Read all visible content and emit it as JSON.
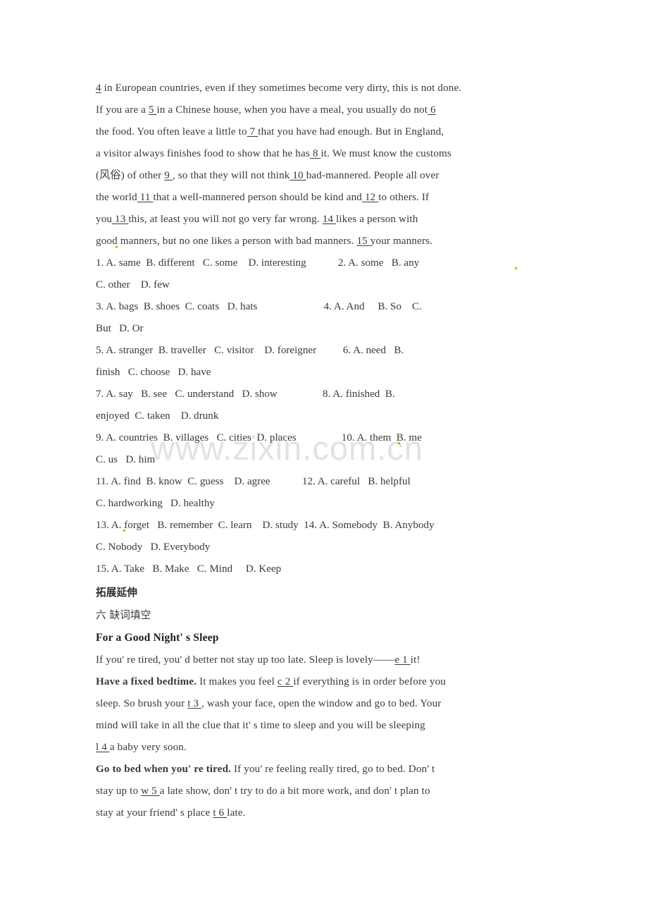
{
  "document": {
    "watermark": "www.zixin.com.cn",
    "cloze_passage": {
      "lines": [
        {
          "id": "l1",
          "parts": [
            {
              "t": "4",
              "style": "blank"
            },
            {
              "t": "  in European countries, even if they sometimes become very dirty, this is not done.",
              "style": "plain"
            }
          ]
        },
        {
          "id": "l2",
          "parts": [
            {
              "t": "If you are a ",
              "style": "plain"
            },
            {
              "t": " 5 ",
              "style": "blank"
            },
            {
              "t": "in a Chinese house, when you have a meal, you usually do not",
              "style": "plain"
            },
            {
              "t": " 6",
              "style": "blank"
            }
          ]
        },
        {
          "id": "l3",
          "parts": [
            {
              "t": "the food. You often leave a little to",
              "style": "plain"
            },
            {
              "t": " 7 ",
              "style": "blank"
            },
            {
              "t": "that you have had enough. But in England,",
              "style": "plain"
            }
          ]
        },
        {
          "id": "l4",
          "parts": [
            {
              "t": "a visitor always finishes food to show that he has",
              "style": "plain"
            },
            {
              "t": " 8 ",
              "style": "blank"
            },
            {
              "t": "it. We must know the customs",
              "style": "plain"
            }
          ]
        },
        {
          "id": "l5",
          "parts": [
            {
              "t": "(风俗) of other ",
              "style": "cn-inline"
            },
            {
              "t": " 9 ",
              "style": "blank"
            },
            {
              "t": ", so that they will not think",
              "style": "plain"
            },
            {
              "t": " 10 ",
              "style": "blank"
            },
            {
              "t": "bad-mannered. People all over",
              "style": "plain"
            }
          ]
        },
        {
          "id": "l6",
          "parts": [
            {
              "t": "the world",
              "style": "plain"
            },
            {
              "t": " 11 ",
              "style": "blank"
            },
            {
              "t": "that a well-mannered person should be kind and",
              "style": "plain"
            },
            {
              "t": " 12 ",
              "style": "blank"
            },
            {
              "t": "to others. If",
              "style": "plain"
            }
          ]
        },
        {
          "id": "l7",
          "parts": [
            {
              "t": "you",
              "style": "plain"
            },
            {
              "t": " 13 ",
              "style": "blank"
            },
            {
              "t": "this, at least you will not go very far wrong. ",
              "style": "plain"
            },
            {
              "t": " 14 ",
              "style": "blank"
            },
            {
              "t": "likes a person with",
              "style": "plain"
            }
          ]
        },
        {
          "id": "l8",
          "parts": [
            {
              "t": "good manners, but no one likes a person with bad manners. ",
              "style": "plain"
            },
            {
              "t": " 15 ",
              "style": "blank"
            },
            {
              "t": " your manners.",
              "style": "plain"
            }
          ]
        }
      ]
    },
    "choices": {
      "lines": [
        "1. A. same  B. different   C. some    D. interesting            2. A. some   B. any",
        "C. other    D. few",
        "3. A. bags  B. shoes  C. coats   D. hats                         4. A. And     B. So    C.",
        "But   D. Or",
        "5. A. stranger  B. traveller   C. visitor    D. foreigner          6. A. need   B.",
        "finish   C. choose   D. have",
        "7. A. say   B. see   C. understand   D. show                 8. A. finished  B.",
        "enjoyed  C. taken    D. drunk",
        "9. A. countries  B. villages   C. cities  D. places                 10. A. them  B. me",
        "C. us   D. him",
        "11. A. find  B. know  C. guess    D. agree            12. A. careful   B. helpful",
        "C. hardworking   D. healthy",
        "13. A. forget   B. remember  C. learn    D. study  14. A. Somebody  B. Anybody",
        "C. Nobody   D. Everybody",
        "15. A. Take   B. Make   C. Mind     D. Keep"
      ]
    },
    "section_heading": "拓展延伸",
    "exercise_heading": "六 缺词填空",
    "passage_title": "For a Good Night' s Sleep",
    "word_fill_passage": {
      "lines": [
        {
          "id": "w1",
          "parts": [
            {
              "t": "If you' re tired, you' d better not stay up too late. Sleep is lovely——",
              "style": "plain"
            },
            {
              "t": "e  1 ",
              "style": "blank"
            },
            {
              "t": " it!",
              "style": "plain"
            }
          ]
        },
        {
          "id": "w2",
          "parts": [
            {
              "t": "Have a fixed bedtime.",
              "style": "bold"
            },
            {
              "t": " It makes you feel ",
              "style": "plain"
            },
            {
              "t": "c  2 ",
              "style": "blank"
            },
            {
              "t": " if everything is in order before you",
              "style": "plain"
            }
          ]
        },
        {
          "id": "w3",
          "parts": [
            {
              "t": "sleep. So brush your ",
              "style": "plain"
            },
            {
              "t": "t  3 ",
              "style": "blank"
            },
            {
              "t": ", wash your face, open the window and go to bed. Your",
              "style": "plain"
            }
          ]
        },
        {
          "id": "w4",
          "parts": [
            {
              "t": "mind will take in all the clue that it' s time to sleep and you will be sleeping",
              "style": "plain"
            }
          ]
        },
        {
          "id": "w5",
          "parts": [
            {
              "t": "l  4  ",
              "style": "blank"
            },
            {
              "t": "a baby very soon.",
              "style": "plain"
            }
          ]
        },
        {
          "id": "w6",
          "parts": [
            {
              "t": "Go to bed when you' re tired.",
              "style": "bold"
            },
            {
              "t": " If you' re feeling really tired, go to bed. Don' t",
              "style": "plain"
            }
          ]
        },
        {
          "id": "w7",
          "parts": [
            {
              "t": "stay up to ",
              "style": "plain"
            },
            {
              "t": "w  5 ",
              "style": "blank"
            },
            {
              "t": "a late show, don' t try to do a bit more work, and don' t plan to",
              "style": "plain"
            }
          ]
        },
        {
          "id": "w8",
          "parts": [
            {
              "t": "stay at your friend' s place ",
              "style": "plain"
            },
            {
              "t": "t  6 ",
              "style": "blank"
            },
            {
              "t": " late.",
              "style": "plain"
            }
          ]
        }
      ]
    },
    "colors": {
      "text": "#3a3a3a",
      "watermark": "#e2e2e2",
      "artifact_dot": "#e8a317",
      "background": "#ffffff"
    }
  }
}
